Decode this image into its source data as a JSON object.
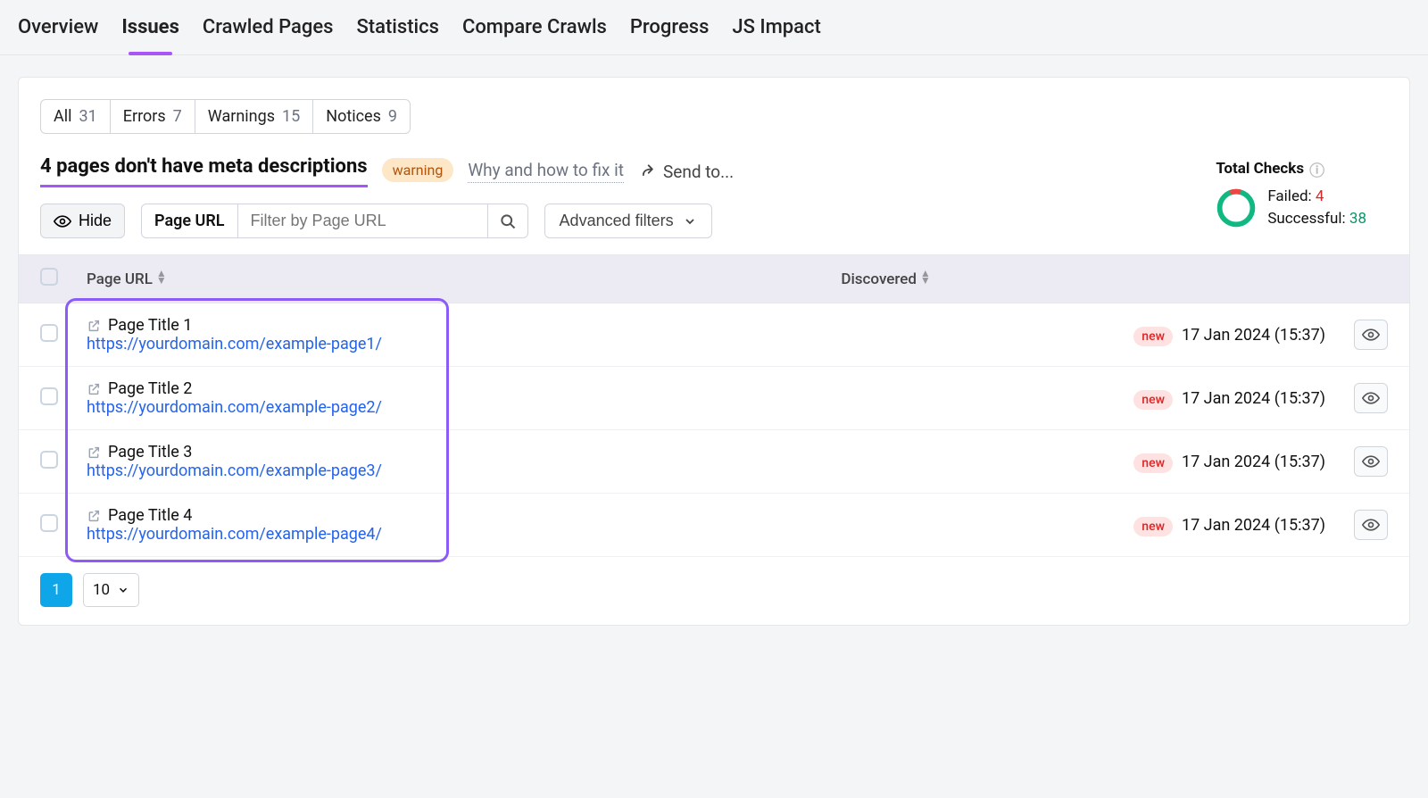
{
  "nav": {
    "tabs": [
      "Overview",
      "Issues",
      "Crawled Pages",
      "Statistics",
      "Compare Crawls",
      "Progress",
      "JS Impact"
    ],
    "activeIndex": 1
  },
  "segments": [
    {
      "label": "All",
      "count": "31"
    },
    {
      "label": "Errors",
      "count": "7"
    },
    {
      "label": "Warnings",
      "count": "15"
    },
    {
      "label": "Notices",
      "count": "9"
    }
  ],
  "issue": {
    "title": "4 pages don't have meta descriptions",
    "badge": "warning",
    "help_link": "Why and how to fix it",
    "send_to": "Send to..."
  },
  "controls": {
    "hide": "Hide",
    "filter_label": "Page URL",
    "filter_placeholder": "Filter by Page URL",
    "advanced": "Advanced filters"
  },
  "stats": {
    "title": "Total Checks",
    "failed_label": "Failed:",
    "failed": "4",
    "success_label": "Successful:",
    "success": "38"
  },
  "table": {
    "col_url": "Page URL",
    "col_discovered": "Discovered",
    "rows": [
      {
        "title": "Page Title 1",
        "url": "https://yourdomain.com/example-page1/",
        "badge": "new",
        "discovered": "17 Jan 2024 (15:37)"
      },
      {
        "title": "Page Title 2",
        "url": "https://yourdomain.com/example-page2/",
        "badge": "new",
        "discovered": "17 Jan 2024 (15:37)"
      },
      {
        "title": "Page Title 3",
        "url": "https://yourdomain.com/example-page3/",
        "badge": "new",
        "discovered": "17 Jan 2024 (15:37)"
      },
      {
        "title": "Page Title 4",
        "url": "https://yourdomain.com/example-page4/",
        "badge": "new",
        "discovered": "17 Jan 2024 (15:37)"
      }
    ]
  },
  "pager": {
    "current": "1",
    "page_size": "10"
  }
}
